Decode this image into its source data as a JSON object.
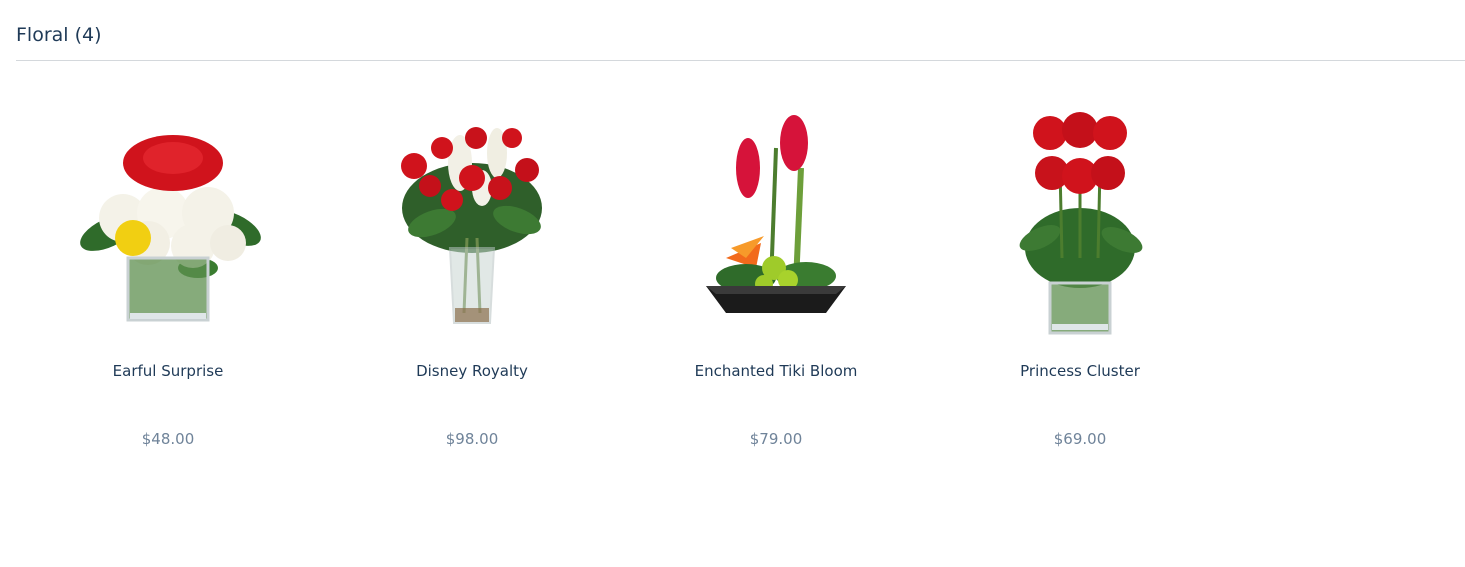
{
  "section": {
    "title": "Floral (4)"
  },
  "products": [
    {
      "name": "Earful Surprise",
      "price": "$48.00",
      "image_icon": "flower-cube-vase-image"
    },
    {
      "name": "Disney Royalty",
      "price": "$98.00",
      "image_icon": "rose-tall-vase-image"
    },
    {
      "name": "Enchanted Tiki Bloom",
      "price": "$79.00",
      "image_icon": "tropical-dish-image"
    },
    {
      "name": "Princess Cluster",
      "price": "$69.00",
      "image_icon": "rose-cluster-cube-image"
    }
  ],
  "colors": {
    "title": "#1f3a57",
    "price": "#6f8399",
    "divider": "#d4d8dc",
    "rose": "#d0131c",
    "leaf": "#2f6b2a"
  }
}
